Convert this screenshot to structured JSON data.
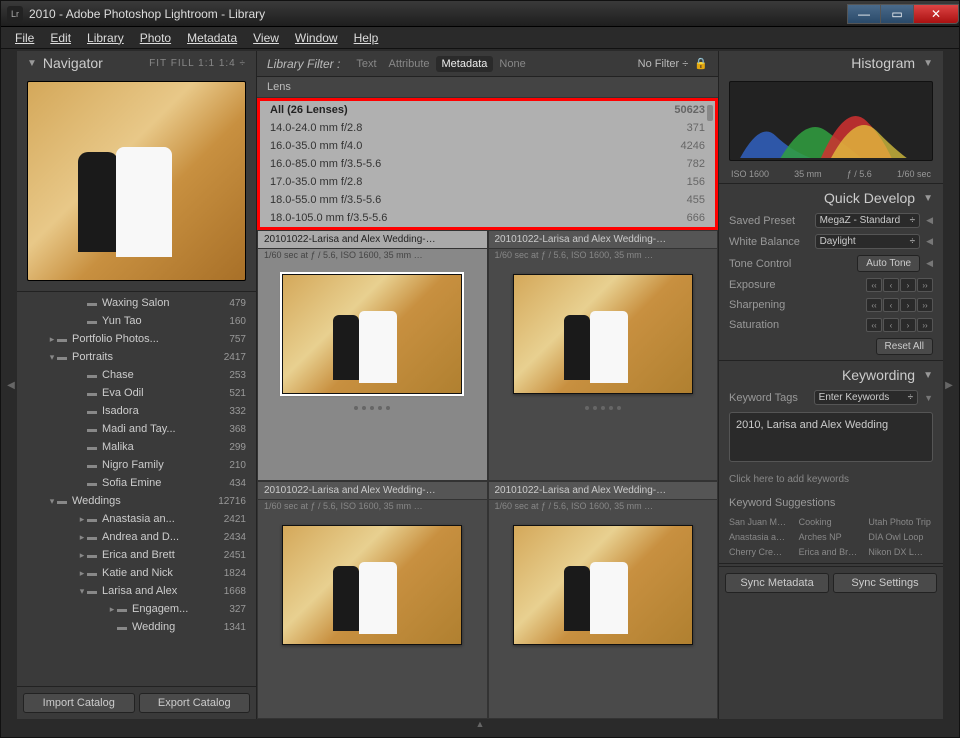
{
  "window": {
    "title": "2010 - Adobe Photoshop Lightroom - Library",
    "appicon_text": "Lr"
  },
  "menubar": [
    "File",
    "Edit",
    "Library",
    "Photo",
    "Metadata",
    "View",
    "Window",
    "Help"
  ],
  "navigator": {
    "title": "Navigator",
    "options": "FIT  FILL  1:1  1:4 ÷"
  },
  "folders": [
    {
      "indent": 60,
      "disclose": "",
      "name": "Waxing Salon",
      "count": "479"
    },
    {
      "indent": 60,
      "disclose": "",
      "name": "Yun Tao",
      "count": "160"
    },
    {
      "indent": 30,
      "disclose": "▸",
      "name": "Portfolio Photos...",
      "count": "757"
    },
    {
      "indent": 30,
      "disclose": "▾",
      "name": "Portraits",
      "count": "2417"
    },
    {
      "indent": 60,
      "disclose": "",
      "name": "Chase",
      "count": "253"
    },
    {
      "indent": 60,
      "disclose": "",
      "name": "Eva Odil",
      "count": "521"
    },
    {
      "indent": 60,
      "disclose": "",
      "name": "Isadora",
      "count": "332"
    },
    {
      "indent": 60,
      "disclose": "",
      "name": "Madi and Tay...",
      "count": "368"
    },
    {
      "indent": 60,
      "disclose": "",
      "name": "Malika",
      "count": "299"
    },
    {
      "indent": 60,
      "disclose": "",
      "name": "Nigro Family",
      "count": "210"
    },
    {
      "indent": 60,
      "disclose": "",
      "name": "Sofia Emine",
      "count": "434"
    },
    {
      "indent": 30,
      "disclose": "▾",
      "name": "Weddings",
      "count": "12716"
    },
    {
      "indent": 60,
      "disclose": "▸",
      "name": "Anastasia an...",
      "count": "2421"
    },
    {
      "indent": 60,
      "disclose": "▸",
      "name": "Andrea and D...",
      "count": "2434"
    },
    {
      "indent": 60,
      "disclose": "▸",
      "name": "Erica and Brett",
      "count": "2451"
    },
    {
      "indent": 60,
      "disclose": "▸",
      "name": "Katie and Nick",
      "count": "1824"
    },
    {
      "indent": 60,
      "disclose": "▾",
      "name": "Larisa and Alex",
      "count": "1668"
    },
    {
      "indent": 90,
      "disclose": "▸",
      "name": "Engagem...",
      "count": "327"
    },
    {
      "indent": 90,
      "disclose": "",
      "name": "Wedding",
      "count": "1341"
    }
  ],
  "left_buttons": {
    "import": "Import Catalog",
    "export": "Export Catalog"
  },
  "filterbar": {
    "label": "Library Filter :",
    "items": [
      "Text",
      "Attribute",
      "Metadata",
      "None"
    ],
    "active": "Metadata",
    "right": "No Filter ÷"
  },
  "lens": {
    "header": "Lens",
    "rows": [
      {
        "name": "All (26 Lenses)",
        "count": "50623",
        "bold": true
      },
      {
        "name": "14.0-24.0 mm f/2.8",
        "count": "371"
      },
      {
        "name": "16.0-35.0 mm f/4.0",
        "count": "4246"
      },
      {
        "name": "16.0-85.0 mm f/3.5-5.6",
        "count": "782"
      },
      {
        "name": "17.0-35.0 mm f/2.8",
        "count": "156"
      },
      {
        "name": "18.0-55.0 mm f/3.5-5.6",
        "count": "455"
      },
      {
        "name": "18.0-105.0 mm f/3.5-5.6",
        "count": "666"
      }
    ]
  },
  "grid_cell": {
    "title": "20101022-Larisa and Alex Wedding-…",
    "sub": "1/60 sec at ƒ / 5.6, ISO 1600, 35 mm …"
  },
  "histogram": {
    "title": "Histogram",
    "labels": [
      "ISO 1600",
      "35 mm",
      "ƒ / 5.6",
      "1/60 sec"
    ]
  },
  "quick_develop": {
    "title": "Quick Develop",
    "saved_preset_label": "Saved Preset",
    "saved_preset_value": "MegaZ - Standard",
    "wb_label": "White Balance",
    "wb_value": "Daylight",
    "tone_label": "Tone Control",
    "auto_tone": "Auto Tone",
    "exposure": "Exposure",
    "sharpening": "Sharpening",
    "saturation": "Saturation",
    "reset": "Reset All"
  },
  "keywording": {
    "title": "Keywording",
    "tags_label": "Keyword Tags",
    "tags_mode": "Enter Keywords",
    "keywords": "2010, Larisa and Alex Wedding",
    "hint": "Click here to add keywords",
    "sugg_title": "Keyword Suggestions",
    "suggestions": [
      "San Juan M…",
      "Cooking",
      "Utah Photo Trip",
      "Anastasia a…",
      "Arches NP",
      "DIA Owl Loop",
      "Cherry Cre…",
      "Erica and Br…",
      "Nikon DX L…"
    ]
  },
  "right_buttons": {
    "sync_meta": "Sync Metadata",
    "sync_set": "Sync Settings"
  }
}
